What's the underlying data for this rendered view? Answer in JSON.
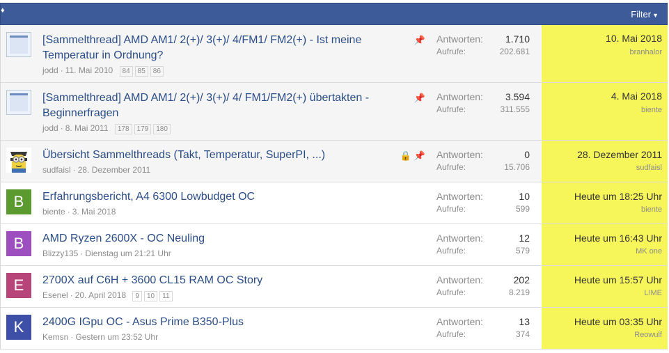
{
  "header": {
    "filter_label": "Filter",
    "corner_glyph": "♦"
  },
  "labels": {
    "replies": "Antworten:",
    "views": "Aufrufe:"
  },
  "threads": [
    {
      "title_line1": "[Sammelthread] AMD AM1/ 2(+)/ 3(+)/ 4/FM1/ FM2(+) - Ist meine",
      "title_line2": "Temperatur in Ordnung?",
      "author": "jodd",
      "date": "11. Mai 2010",
      "pages": [
        "84",
        "85",
        "86"
      ],
      "replies": "1.710",
      "views": "202.681",
      "last_date": "10. Mai 2018",
      "last_user": "branhalor"
    },
    {
      "title_line1": "[Sammelthread] AMD AM1/ 2(+)/ 3(+)/ 4/ FM1/FM2(+) übertakten -",
      "title_line2": "Beginnerfragen",
      "author": "jodd",
      "date": "8. Mai 2011",
      "pages": [
        "178",
        "179",
        "180"
      ],
      "replies": "3.594",
      "views": "311.555",
      "last_date": "4. Mai 2018",
      "last_user": "biente"
    },
    {
      "title": "Übersicht Sammelthreads (Takt, Temperatur, SuperPI, ...)",
      "author": "sudfaisl",
      "date": "28. Dezember 2011",
      "replies": "0",
      "views": "15.706",
      "last_date": "28. Dezember 2011",
      "last_user": "sudfaisl"
    },
    {
      "avatar_letter": "B",
      "avatar_color": "#5a9a2f",
      "title": "Erfahrungsbericht, A4 6300 Lowbudget OC",
      "author": "biente",
      "date": "3. Mai 2018",
      "replies": "10",
      "views": "599",
      "last_date": "Heute um 18:25 Uhr",
      "last_user": "biente"
    },
    {
      "avatar_letter": "B",
      "avatar_color": "#9d4fc0",
      "title": "AMD Ryzen 2600X - OC Neuling",
      "author": "Blizzy135",
      "date": "Dienstag um 21:21 Uhr",
      "replies": "12",
      "views": "579",
      "last_date": "Heute um 16:43 Uhr",
      "last_user": "MK one"
    },
    {
      "avatar_letter": "E",
      "avatar_color": "#b8457a",
      "title": "2700X auf C6H + 3600 CL15 RAM OC Story",
      "author": "Esenel",
      "date": "20. April 2018",
      "pages": [
        "9",
        "10",
        "11"
      ],
      "replies": "202",
      "views": "8.219",
      "last_date": "Heute um 15:57 Uhr",
      "last_user": "L!ME"
    },
    {
      "avatar_letter": "K",
      "avatar_color": "#3e4fa8",
      "title": "2400G IGpu OC - Asus Prime B350-Plus",
      "author": "Kemsn",
      "date": "Gestern um 23:52 Uhr",
      "replies": "13",
      "views": "374",
      "last_date": "Heute um 03:35 Uhr",
      "last_user": "Reowulf"
    }
  ],
  "icons": {
    "pin": "pin-icon",
    "lock": "lock-icon"
  },
  "colors": {
    "header": "#3d5a99",
    "link": "#2b4d87",
    "highlight": "#f6f55a",
    "pin": "#cc7a2a"
  }
}
